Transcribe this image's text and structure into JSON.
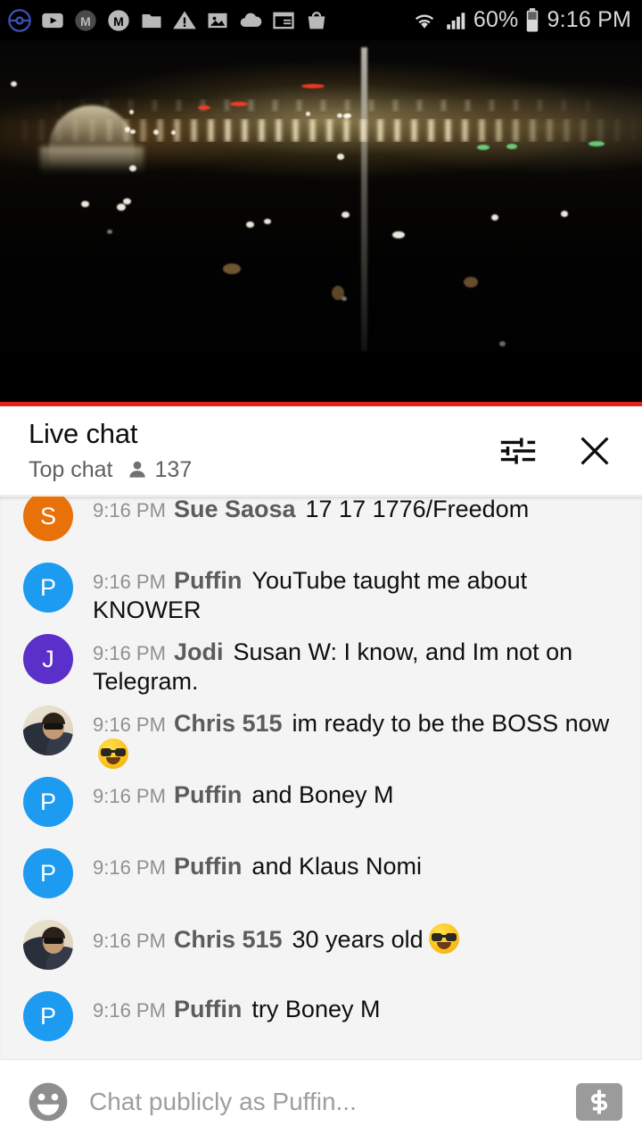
{
  "statusbar": {
    "icons": [
      {
        "name": "pokemon-go-icon",
        "label": "Pokemon Go"
      },
      {
        "name": "youtube-icon",
        "label": "YouTube"
      },
      {
        "name": "m-app-dark-icon",
        "label": "M app"
      },
      {
        "name": "m-app-light-icon",
        "label": "M app"
      },
      {
        "name": "folder-icon",
        "label": "File manager"
      },
      {
        "name": "warning-icon",
        "label": "Warning"
      },
      {
        "name": "image-icon",
        "label": "Photos"
      },
      {
        "name": "cloud-icon",
        "label": "Cloud"
      },
      {
        "name": "notes-icon",
        "label": "Notes"
      },
      {
        "name": "shopping-bag-icon",
        "label": "Store"
      }
    ],
    "wifi_icon": "wifi-icon",
    "signal_icon": "signal-bars-icon",
    "battery_percent": "60%",
    "battery_icon": "battery-icon",
    "clock": "9:16 PM"
  },
  "video": {
    "description": "Night cityscape live stream",
    "progress_percent": 100,
    "progress_color": "#e62117"
  },
  "chat_header": {
    "title": "Live chat",
    "mode": "Top chat",
    "viewer_icon": "person-icon",
    "viewer_count": "137",
    "settings_icon": "tune-sliders-icon",
    "close_icon": "close-x-icon"
  },
  "messages": [
    {
      "avatar_type": "letter",
      "avatar_letter": "S",
      "avatar_color": "#e8710a",
      "time": "9:16 PM",
      "author": "Sue Saosa",
      "text": "17 17 1776/Freedom",
      "emoji": ""
    },
    {
      "avatar_type": "letter",
      "avatar_letter": "P",
      "avatar_color": "#1d9bf0",
      "time": "9:16 PM",
      "author": "Puffin",
      "text": "YouTube taught me about KNOWER",
      "emoji": ""
    },
    {
      "avatar_type": "letter",
      "avatar_letter": "J",
      "avatar_color": "#5b2fc9",
      "time": "9:16 PM",
      "author": "Jodi",
      "text": "Susan W: I know, and Im not on Telegram.",
      "emoji": ""
    },
    {
      "avatar_type": "photo",
      "avatar_letter": "",
      "avatar_color": "#e8e0cf",
      "time": "9:16 PM",
      "author": "Chris 515",
      "text": "im ready to be the BOSS now",
      "emoji": "sunglasses-face-emoji"
    },
    {
      "avatar_type": "letter",
      "avatar_letter": "P",
      "avatar_color": "#1d9bf0",
      "time": "9:16 PM",
      "author": "Puffin",
      "text": "and Boney M",
      "emoji": ""
    },
    {
      "avatar_type": "letter",
      "avatar_letter": "P",
      "avatar_color": "#1d9bf0",
      "time": "9:16 PM",
      "author": "Puffin",
      "text": "and Klaus Nomi",
      "emoji": ""
    },
    {
      "avatar_type": "photo",
      "avatar_letter": "",
      "avatar_color": "#e8e0cf",
      "time": "9:16 PM",
      "author": "Chris 515",
      "text": "30 years old",
      "emoji": "sunglasses-face-emoji"
    },
    {
      "avatar_type": "letter",
      "avatar_letter": "P",
      "avatar_color": "#1d9bf0",
      "time": "9:16 PM",
      "author": "Puffin",
      "text": "try Boney M",
      "emoji": ""
    }
  ],
  "input_bar": {
    "emoji_icon": "smiley-face-icon",
    "placeholder": "Chat publicly as Puffin...",
    "value": "",
    "superchat_icon": "dollar-superchat-icon"
  }
}
